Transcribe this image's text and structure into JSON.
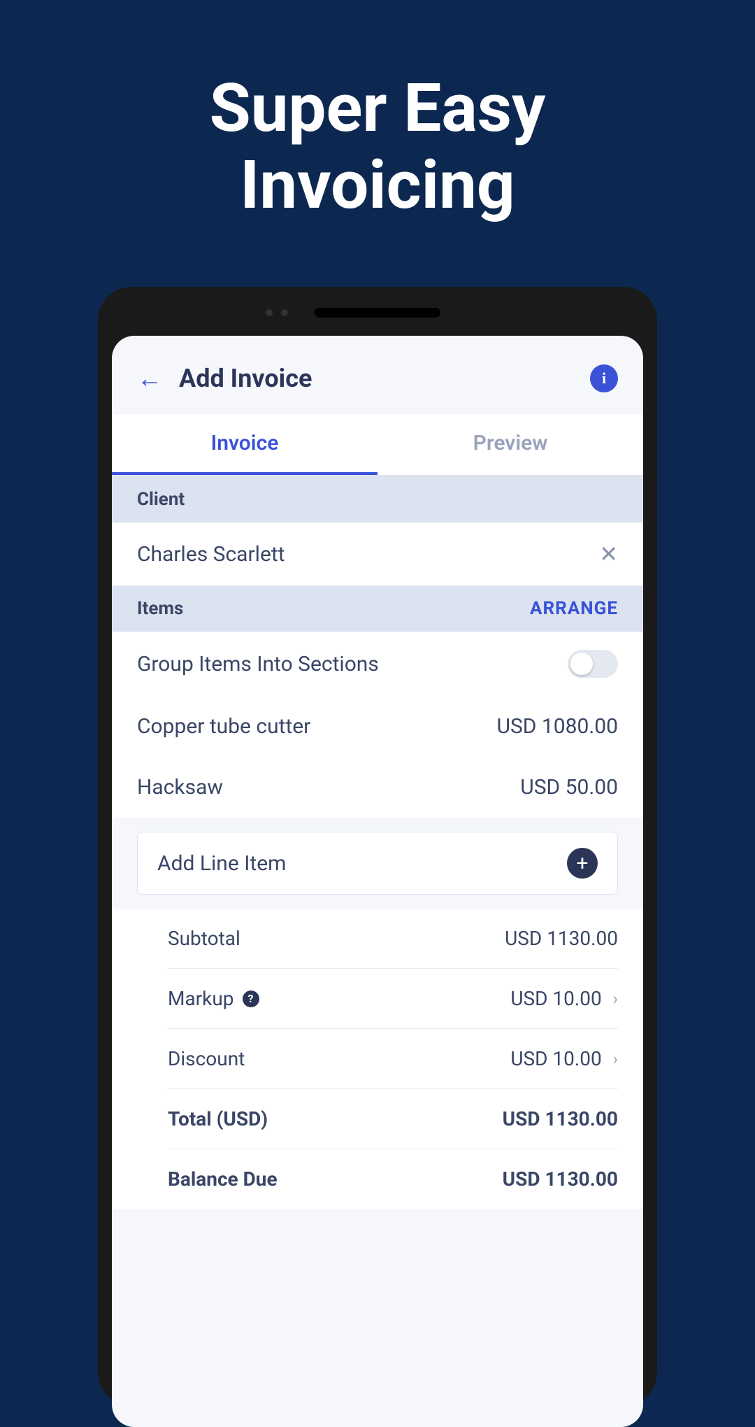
{
  "marketing": {
    "title_line1": "Super Easy",
    "title_line2": "Invoicing"
  },
  "header": {
    "title": "Add Invoice"
  },
  "tabs": {
    "invoice": "Invoice",
    "preview": "Preview"
  },
  "sections": {
    "client_label": "Client",
    "items_label": "Items",
    "arrange_label": "ARRANGE"
  },
  "client": {
    "name": "Charles Scarlett"
  },
  "group_toggle": {
    "label": "Group Items Into Sections"
  },
  "items": [
    {
      "name": "Copper tube cutter",
      "price": "USD  1080.00"
    },
    {
      "name": "Hacksaw",
      "price": "USD  50.00"
    }
  ],
  "add_line": {
    "label": "Add Line Item"
  },
  "summary": {
    "subtotal_label": "Subtotal",
    "subtotal_value": "USD  1130.00",
    "markup_label": "Markup",
    "markup_value": "USD  10.00",
    "discount_label": "Discount",
    "discount_value": "USD  10.00",
    "total_label": "Total (USD)",
    "total_value": "USD  1130.00",
    "balance_label": "Balance Due",
    "balance_value": "USD  1130.00"
  }
}
